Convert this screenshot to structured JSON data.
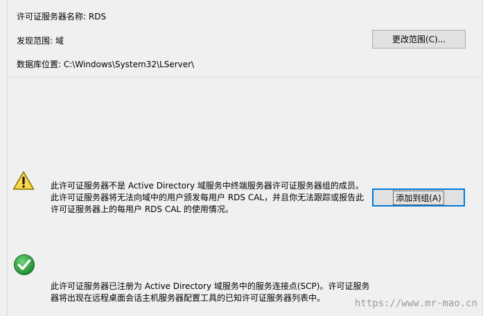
{
  "server": {
    "name_label": "许可证服务器名称:",
    "name_value": "RDS",
    "scope_label": "发现范围:",
    "scope_value": "域",
    "db_label": "数据库位置:",
    "db_value": "C:\\Windows\\System32\\LServer\\"
  },
  "buttons": {
    "change_scope": "更改范围(C)...",
    "add_to_group": "添加到组(A)"
  },
  "warning": {
    "icon": "warning-icon",
    "text": "此许可证服务器不是 Active Directory 域服务中终端服务器许可证服务器组的成员。\n此许可证服务器将无法向域中的用户颁发每用户 RDS CAL，并且你无法跟踪或报告此\n许可证服务器上的每用户 RDS CAL 的使用情况。"
  },
  "success": {
    "icon": "check-icon",
    "text": "此许可证服务器已注册为 Active Directory 域服务中的服务连接点(SCP)。许可证服务\n器将出现在远程桌面会话主机服务器配置工具的已知许可证服务器列表中。"
  },
  "watermark": "https://www.mr-mao.cn",
  "colors": {
    "warning_fill": "#f9d84a",
    "check_fill": "#2e9e3e",
    "focus_border": "#0078d7"
  }
}
